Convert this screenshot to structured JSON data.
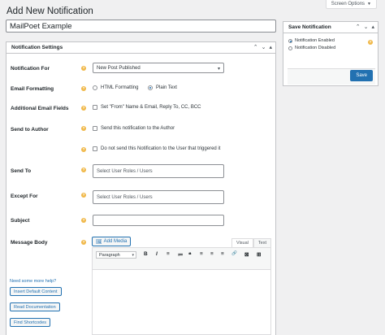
{
  "screen_options": {
    "label": "Screen Options",
    "caret": "▼"
  },
  "page_title": "Add New Notification",
  "title_value": "MailPoet Example",
  "settings": {
    "heading": "Notification Settings",
    "controls": [
      "⌃",
      "⌄",
      "▴"
    ],
    "help_glyph": "?",
    "notification_for": {
      "label": "Notification For",
      "value": "New Post Published",
      "caret": "▾"
    },
    "email_formatting": {
      "label": "Email Formatting",
      "options": [
        "HTML Formatting",
        "Plain Text"
      ],
      "selected": "Plain Text"
    },
    "additional_fields": {
      "label": "Additional Email Fields",
      "option": "Set \"From\" Name & Email, Reply To, CC, BCC"
    },
    "send_to_author": {
      "label": "Send to Author",
      "option1": "Send this notification to the Author",
      "option2": "Do not send this Notification to the User that triggered it"
    },
    "send_to": {
      "label": "Send To",
      "placeholder": "Select User Roles / Users"
    },
    "except_for": {
      "label": "Except For",
      "placeholder": "Select User Roles / Users"
    },
    "subject": {
      "label": "Subject",
      "value": ""
    },
    "message_body": {
      "label": "Message Body",
      "add_media": "Add Media",
      "tabs": [
        "Visual",
        "Text"
      ],
      "active_tab": "Visual",
      "paragraph": "Paragraph",
      "paragraph_caret": "▾",
      "toolbar": [
        "B",
        "I",
        "≡",
        "≔",
        "❝",
        "≡",
        "≡",
        "≡",
        "🔗",
        "⊠",
        "⊞"
      ]
    },
    "need_more_help": "Need some more help?",
    "buttons": [
      "Insert Default Content",
      "Read Documentation",
      "Find Shortcodes"
    ]
  },
  "save_panel": {
    "heading": "Save Notification",
    "controls": [
      "⌃",
      "⌄",
      "▴"
    ],
    "options": [
      "Notification Enabled",
      "Notification Disabled"
    ],
    "selected": "Notification Enabled",
    "help_glyph": "?",
    "save_label": "Save"
  },
  "colors": {
    "accent": "#2271b1",
    "help": "#f0b849",
    "background": "#f0f0f1"
  }
}
